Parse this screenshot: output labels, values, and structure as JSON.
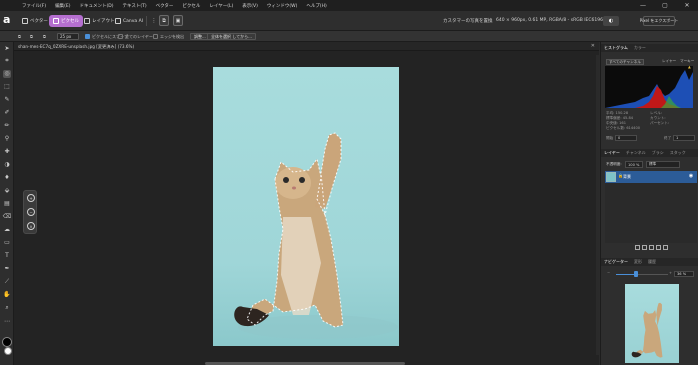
{
  "menu": {
    "items": [
      "ファイル(F)",
      "編集(E)",
      "ドキュメント(D)",
      "テキスト(T)",
      "ベクター",
      "ピクセル",
      "レイヤー(L)",
      "表示(V)",
      "ウィンドウ(W)",
      "ヘルプ(H)"
    ]
  },
  "window_controls": {
    "minimize": "—",
    "maximize": "▢",
    "close": "✕"
  },
  "personas": [
    {
      "label": "ベクター",
      "active": false
    },
    {
      "label": "ピクセル",
      "active": true
    },
    {
      "label": "レイアウト",
      "active": false
    },
    {
      "label": "Canva AI",
      "active": false
    }
  ],
  "toolbar": {
    "tab_title": "カスタマーの写真を置換",
    "doc_info": "640 × 960px, 0.61 MP, RGBA/8 - sRGB IEC61966-2.1",
    "export_label": "Pixel をエクスポート",
    "user_glyph": "◐"
  },
  "context": {
    "brush_size": "25 px",
    "snap_label": "ピクセルにスナップ",
    "all_layers_label": "全てのレイヤー",
    "edge_label": "エッジを検出",
    "refine_btn": "調整...",
    "selection_btn": "全体を選択 してから..."
  },
  "document": {
    "tab_name": "shan-mes-EC7q_0ZXRE-unsplash.jpg [変更済み] (73.6%)",
    "close": "✕"
  },
  "histogram": {
    "tabs": [
      "ヒストグラム",
      "カラー"
    ],
    "channel": "すべてのチャンネル",
    "layer_label": "レイヤー",
    "marquee_label": "マーキー",
    "stats_left": [
      "平均: 150.28",
      "標準偏差: 45.84",
      "中央値: 161",
      "ピクセル数: 614400"
    ],
    "stats_right": [
      "レベル:",
      "カウント:",
      "パーセント:"
    ],
    "start_label": "開始",
    "start_value": "0",
    "end_label": "終了",
    "end_value": "1",
    "warning_glyph": "▲"
  },
  "layers": {
    "tabs": [
      "レイヤー",
      "チャンネル",
      "ブラシ",
      "スタック"
    ],
    "opacity_label": "不透明度:",
    "opacity_value": "100 %",
    "blend_mode": "標準",
    "layer_name": "背景",
    "lock_glyph": "🔒",
    "eye_glyph": "◉"
  },
  "navigator": {
    "tabs": [
      "ナビゲーター",
      "変形",
      "履歴"
    ],
    "zoom_value": "36 %",
    "zoom_fraction": 0.36
  },
  "colors": {
    "persona_active": "#b56fd0",
    "selection": "#2c5c98",
    "accent": "#4a8fd8",
    "image_bg": "#a8dcdd"
  }
}
